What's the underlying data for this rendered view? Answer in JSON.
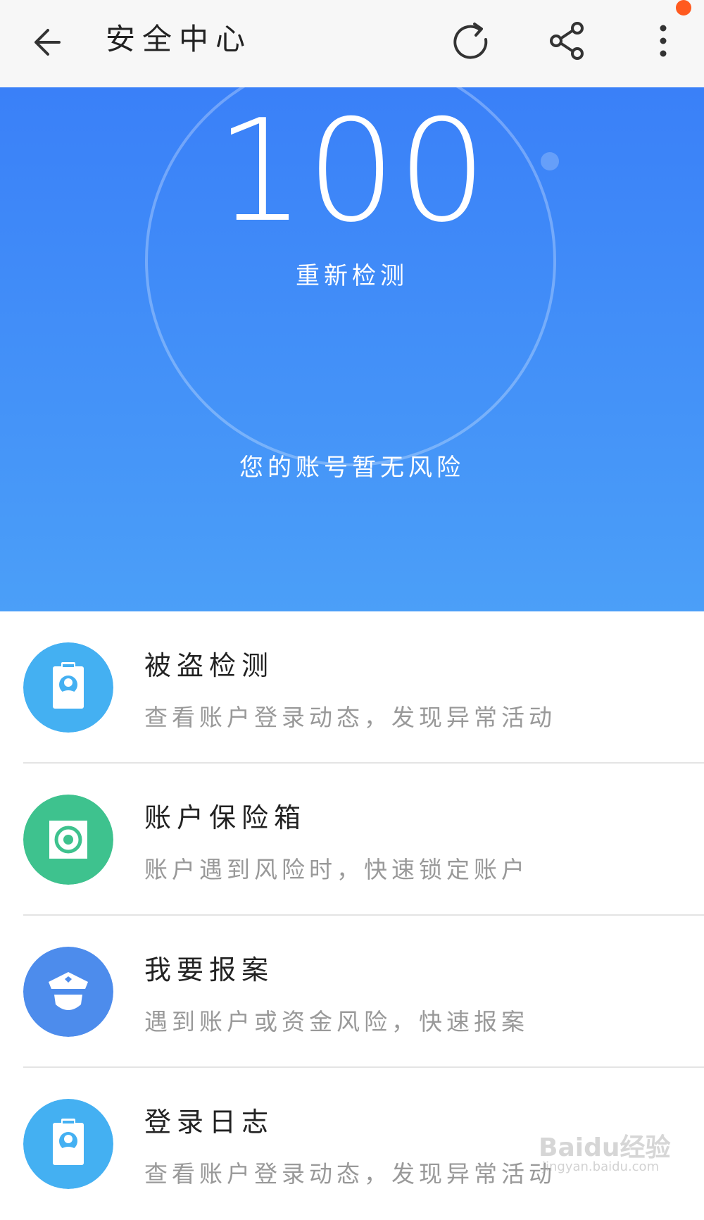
{
  "header": {
    "title": "安全中心",
    "icons": [
      "back-arrow-icon",
      "refresh-icon",
      "share-icon",
      "more-vertical-icon"
    ],
    "notification_color": "#ff5a1f"
  },
  "hero": {
    "score": "100",
    "recheck_label": "重新检测",
    "status_text": "您的账号暂无风险",
    "gradient_top": "#3a80f8",
    "gradient_bottom": "#4b9ff8"
  },
  "items": [
    {
      "name": "被盗检测",
      "desc": "查看账户登录动态，发现异常活动",
      "icon": "id-badge-icon",
      "color": "#44b0f2"
    },
    {
      "name": "账户保险箱",
      "desc": "账户遇到风险时，快速锁定账户",
      "icon": "safe-box-icon",
      "color": "#3ec28e"
    },
    {
      "name": "我要报案",
      "desc": "遇到账户或资金风险，快速报案",
      "icon": "police-icon",
      "color": "#4d8cec"
    },
    {
      "name": "登录日志",
      "desc": "查看账户登录动态，发现异常活动",
      "icon": "id-badge-icon",
      "color": "#44b0f2"
    }
  ],
  "watermark": {
    "text": "Baidu经验",
    "sub": "jingyan.baidu.com"
  }
}
